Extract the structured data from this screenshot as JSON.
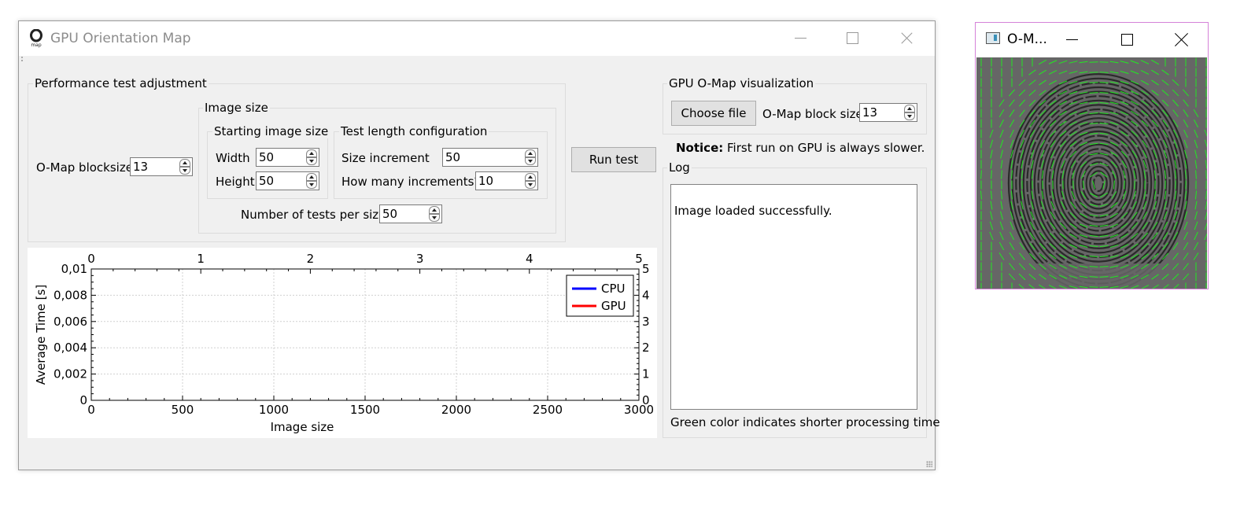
{
  "main_window": {
    "title": "GPU Orientation Map",
    "performance": {
      "title": "Performance test adjustment",
      "omap_blocksize_label": "O-Map blocksize",
      "omap_blocksize_value": "13",
      "image_size": {
        "title": "Image size",
        "starting": {
          "title": "Starting image size",
          "width_label": "Width",
          "width_value": "50",
          "height_label": "Height",
          "height_value": "50"
        },
        "test_length": {
          "title": "Test length configuration",
          "increment_label": "Size increment",
          "increment_value": "50",
          "count_label": "How many increments?",
          "count_value": "10"
        },
        "tests_per_size_label": "Number of tests per size",
        "tests_per_size_value": "50"
      },
      "run_button": "Run test"
    },
    "visualization": {
      "title": "GPU O-Map visualization",
      "choose_file": "Choose file",
      "block_size_label": "O-Map block size",
      "block_size_value": "13"
    },
    "notice": {
      "bold": "Notice:",
      "text": " First run on GPU is always slower."
    },
    "log": {
      "title": "Log",
      "text": "Image loaded successfully.",
      "footer": "Green color indicates shorter processing time"
    }
  },
  "chart_data": {
    "type": "line",
    "xlabel": "Image size",
    "ylabel": "Average Time [s]",
    "xlim": [
      0,
      3000
    ],
    "ylim": [
      0,
      0.01
    ],
    "x_ticks": [
      "0",
      "500",
      "1000",
      "1500",
      "2000",
      "2500",
      "3000"
    ],
    "y_ticks": [
      "0",
      "0,002",
      "0,004",
      "0,006",
      "0,008",
      "0,01"
    ],
    "x2_ticks": [
      "0",
      "1",
      "2",
      "3",
      "4",
      "5"
    ],
    "y2_ticks": [
      "0",
      "1",
      "2",
      "3",
      "4",
      "5"
    ],
    "grid": true,
    "legend_position": "top-right",
    "series": [
      {
        "name": "CPU",
        "color": "#0000ff",
        "x": [],
        "y": []
      },
      {
        "name": "GPU",
        "color": "#ff0000",
        "x": [],
        "y": []
      }
    ]
  },
  "omap_window": {
    "title": "O-M...",
    "image": "fingerprint-orientation-map"
  }
}
